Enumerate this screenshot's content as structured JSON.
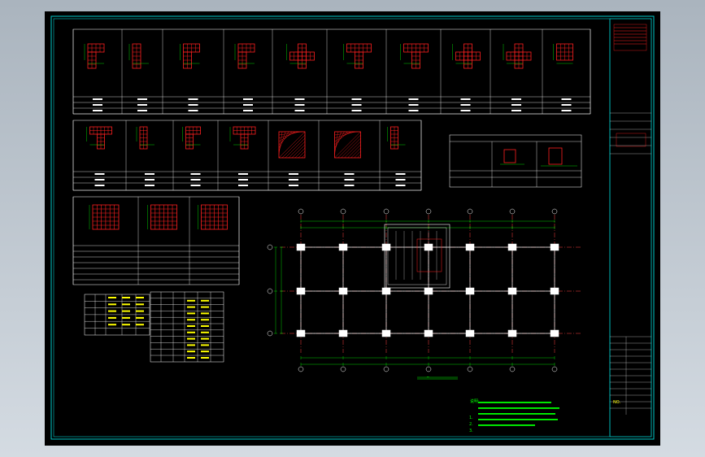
{
  "window": {
    "background": "#c0c8d0",
    "canvas_color": "#000000"
  },
  "colors": {
    "frame": "#00c8c8",
    "concrete": "#ff2020",
    "dim": "#00ff00",
    "text": "#ffffff",
    "note": "#00ff00",
    "grid": "#ff4040",
    "note_yellow": "#ffff00"
  },
  "drawing": {
    "plan_caption": "_",
    "notes_title": "说明:",
    "notes": [
      "1.",
      "2.",
      "3."
    ],
    "titleblock_label": "NO."
  }
}
